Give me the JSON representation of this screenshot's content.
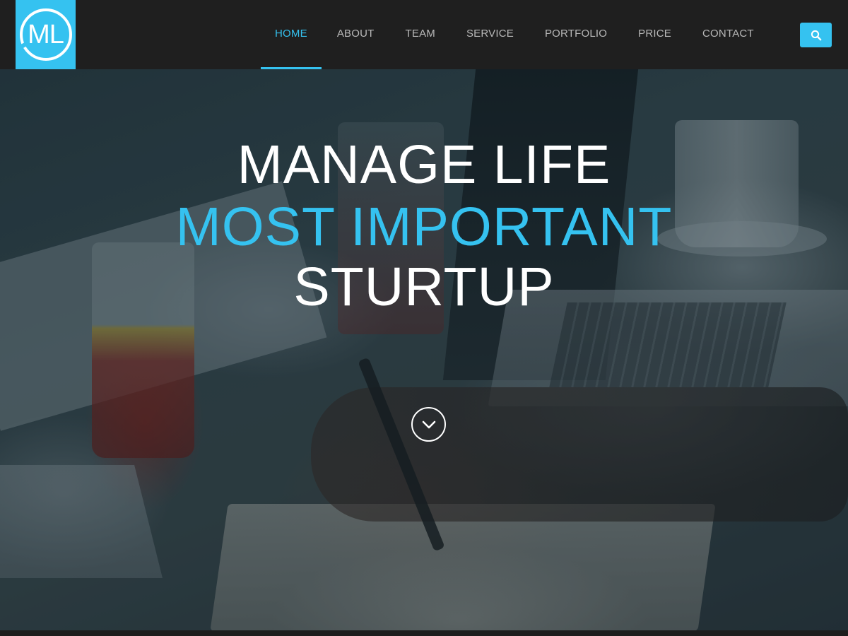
{
  "logo": {
    "text": "ML"
  },
  "nav": {
    "items": [
      {
        "label": "HOME",
        "active": true
      },
      {
        "label": "ABOUT",
        "active": false
      },
      {
        "label": "TEAM",
        "active": false
      },
      {
        "label": "SERVICE",
        "active": false
      },
      {
        "label": "PORTFOLIO",
        "active": false
      },
      {
        "label": "PRICE",
        "active": false
      },
      {
        "label": "CONTACT",
        "active": false
      }
    ],
    "search_icon": "search-icon"
  },
  "hero": {
    "line1": "MANAGE LIFE",
    "line2": "MOST IMPORTANT",
    "line3": "STURTUP",
    "scroll_icon": "chevron-down-icon"
  },
  "colors": {
    "accent": "#35c2f0",
    "navbar": "#1f1f1f",
    "nav_text": "#b9b9b9",
    "hero_text": "#ffffff"
  }
}
